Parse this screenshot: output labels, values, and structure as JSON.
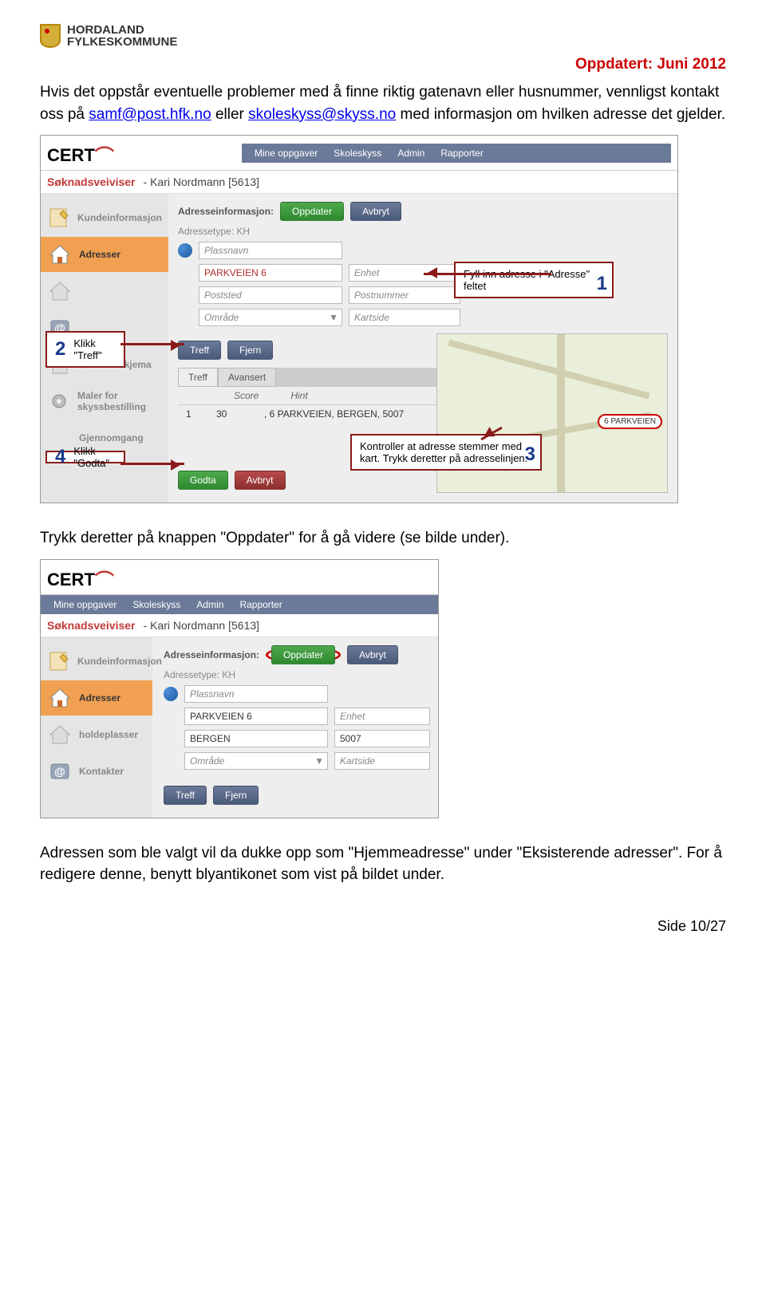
{
  "header": {
    "org1": "HORDALAND",
    "org2": "FYLKESKOMMUNE"
  },
  "updated": "Oppdatert: Juni 2012",
  "p1a": "Hvis det oppstår eventuelle problemer med å finne riktig gatenavn eller husnummer, vennligst kontakt oss på ",
  "email1": "samf@post.hfk.no",
  "p1b": " eller ",
  "email2": "skoleskyss@skyss.no",
  "p1c": " med informasjon om hvilken adresse det gjelder.",
  "p2": "Trykk deretter på knappen \"Oppdater\" for å gå videre (se bilde under).",
  "p3": "Adressen som ble valgt vil da dukke opp som \"Hjemmeadresse\" under \"Eksisterende adresser\". For å redigere denne, benytt blyantikonet som vist på bildet under.",
  "footer": "Side 10/27",
  "cert": {
    "logo": "CERT",
    "wizard": "Søknadsveiviser",
    "user": "- Kari Nordmann [5613]"
  },
  "menu": {
    "m1": "Mine oppgaver",
    "m2": "Skoleskyss",
    "m3": "Admin",
    "m4": "Rapporter"
  },
  "sidebar": {
    "s1": "Kundeinformasjon",
    "s2": "Adresser",
    "s3": "holdeplasser",
    "s4": "Kontakter",
    "s5": "Søknadsskjema",
    "s6": "Maler for skyssbestilling",
    "s7": "Gjennomgang"
  },
  "form": {
    "addrinfo": "Adresseinformasjon:",
    "oppdater": "Oppdater",
    "avbryt": "Avbryt",
    "type": "Adressetype: KH",
    "plass": "Plassnavn",
    "park": "PARKVEIEN 6",
    "enhet": "Enhet",
    "poststed": "Poststed",
    "postnr": "Postnummer",
    "omrade": "Område",
    "kartside": "Kartside",
    "bergen": "BERGEN",
    "post5007": "5007",
    "treff_btn": "Treff",
    "fjern_btn": "Fjern",
    "godta_btn": "Godta",
    "avbryt_btn": "Avbryt",
    "tab_treff": "Treff",
    "tab_avansert": "Avansert",
    "col_score": "Score",
    "col_hint": "Hint",
    "row_n": "1",
    "row_score": "30",
    "row_hint": ", 6 PARKVEIEN, BERGEN, 5007"
  },
  "map": {
    "marker": "6 PARKVEIEN"
  },
  "callouts": {
    "c1": "Fyll inn adresse i \"Adresse\" feltet",
    "c2a": "Klikk",
    "c2b": "\"Treff\"",
    "c3": "Kontroller at adresse stemmer med kart. Trykk deretter på adresselinjen.",
    "c4a": "Klikk",
    "c4b": "\"Godta\""
  }
}
